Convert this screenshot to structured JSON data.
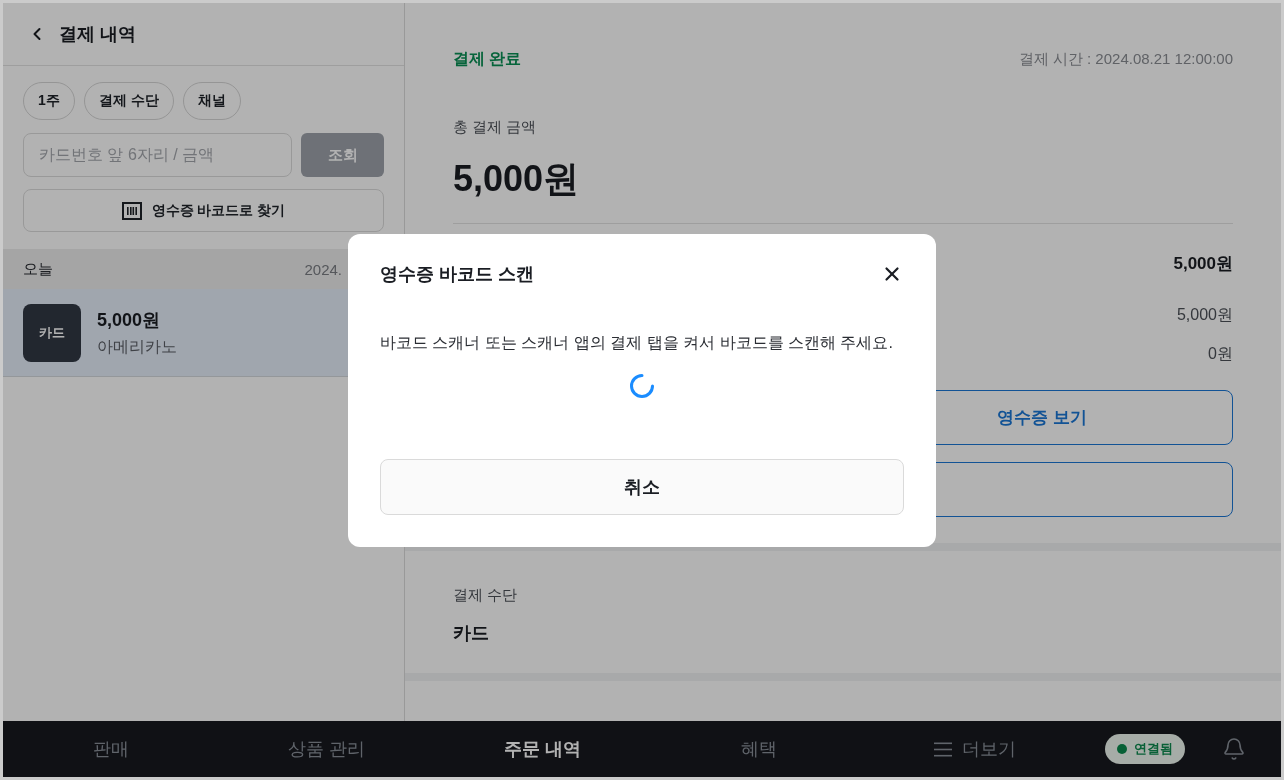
{
  "header": {
    "title": "결제 내역"
  },
  "filters": [
    {
      "label": "1주"
    },
    {
      "label": "결제 수단"
    },
    {
      "label": "채널"
    }
  ],
  "search": {
    "placeholder": "카드번호 앞 6자리 / 금액",
    "button": {
      "label": "조회",
      "disabled": true
    }
  },
  "barcode_button": {
    "label": "영수증 바코드로 찾기"
  },
  "payment_groups": [
    {
      "label": "오늘",
      "date": "2024.",
      "items": [
        {
          "method": "카드",
          "amount": "5,000원",
          "product": "아메리카노",
          "selected": true
        }
      ]
    }
  ],
  "detail": {
    "status": "결제 완료",
    "time": "결제 시간 : 2024.08.21 12:00:00",
    "total_label": "총 결제 금액",
    "total": "5,000원",
    "rows": [
      {
        "kind": "total",
        "value": "5,000원"
      },
      {
        "kind": "plain",
        "value": "5,000원"
      },
      {
        "kind": "plain",
        "value": "0원"
      }
    ],
    "actions": [
      {
        "kind": "half",
        "label": "영수증 보기"
      },
      {
        "kind": "full"
      }
    ],
    "method_label": "결제 수단",
    "method": "카드"
  },
  "nav": {
    "tabs": [
      {
        "kind": "text",
        "label": "판매",
        "selected": false
      },
      {
        "kind": "text",
        "label": "상품 관리",
        "selected": false
      },
      {
        "kind": "text",
        "label": "주문 내역",
        "selected": true
      },
      {
        "kind": "text",
        "label": "혜택",
        "selected": false
      },
      {
        "kind": "menu",
        "label": "더보기",
        "selected": false
      }
    ],
    "status": {
      "label": "연결됨",
      "connected": true
    }
  },
  "modal": {
    "title": "영수증 바코드 스캔",
    "message": "바코드 스캐너 또는 스캐너 앱의 결제 탭을 켜서 바코드를 스캔해 주세요.",
    "loading": true,
    "cancel": "취소"
  }
}
